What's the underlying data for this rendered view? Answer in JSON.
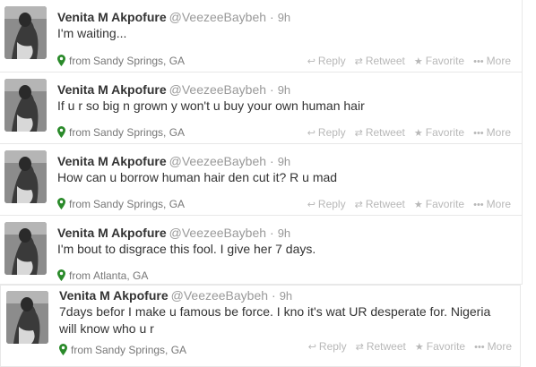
{
  "tweets": [
    {
      "name": "Venita M Akpofure",
      "handle": "@VeezeeBaybeh",
      "time": "9h",
      "text": "I'm waiting...",
      "from": "from",
      "location": "Sandy Springs, GA"
    },
    {
      "name": "Venita M Akpofure",
      "handle": "@VeezeeBaybeh",
      "time": "9h",
      "text": "If u r so big n grown y won't u buy your own human hair",
      "from": "from",
      "location": "Sandy Springs, GA"
    },
    {
      "name": "Venita M Akpofure",
      "handle": "@VeezeeBaybeh",
      "time": "9h",
      "text": "How can u borrow human hair den cut it? R u mad",
      "from": "from",
      "location": "Sandy Springs, GA"
    },
    {
      "name": "Venita M Akpofure",
      "handle": "@VeezeeBaybeh",
      "time": "9h",
      "text": "I'm bout to disgrace this fool. I give her 7 days.",
      "from": "from",
      "location": "Atlanta, GA"
    },
    {
      "name": "Venita M Akpofure",
      "handle": "@VeezeeBaybeh",
      "time": "9h",
      "text": "7days befor I make u famous be force. I kno it's wat UR desperate for. Nigeria will know who u r",
      "from": "from",
      "location": "Sandy Springs, GA"
    }
  ],
  "actions": {
    "reply": "Reply",
    "retweet": "Retweet",
    "favorite": "Favorite",
    "more": "More"
  },
  "icons": {
    "pin": "location-pin-icon",
    "reply": "reply-icon",
    "retweet": "retweet-icon",
    "favorite": "star-icon",
    "more": "more-dots-icon"
  },
  "colors": {
    "geo_pin": "#2a8a2a",
    "muted": "#999999",
    "action": "#b8b8b8"
  }
}
